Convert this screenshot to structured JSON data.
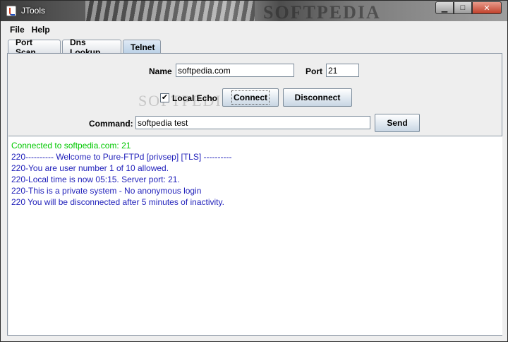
{
  "window": {
    "title": "JTools",
    "title_watermark": "SOFTPEDIA"
  },
  "menu": [
    "File",
    "Help"
  ],
  "tabs": [
    {
      "label": "Port Scan",
      "active": false
    },
    {
      "label": "Dns Lookup",
      "active": false
    },
    {
      "label": "Telnet",
      "active": true
    }
  ],
  "telnet": {
    "name_label": "Name",
    "name_value": "softpedia.com",
    "port_label": "Port",
    "port_value": "21",
    "local_echo_label": "Local Echo",
    "local_echo_checked": true,
    "connect_label": "Connect",
    "disconnect_label": "Disconnect",
    "command_label": "Command:",
    "command_value": "softpedia test",
    "send_label": "Send",
    "watermark": "SOFTPEDIA"
  },
  "output": {
    "lines": [
      {
        "text": "Connected to softpedia.com: 21",
        "color": "#00c800"
      },
      {
        "text": "220---------- Welcome to Pure-FTPd [privsep] [TLS] ----------",
        "color": "#2222bb"
      },
      {
        "text": "220-You are user number 1 of 10 allowed.",
        "color": "#2222bb"
      },
      {
        "text": "220-Local time is now 05:15. Server port: 21.",
        "color": "#2222bb"
      },
      {
        "text": "220-This is a private system - No anonymous login",
        "color": "#2222bb"
      },
      {
        "text": "220 You will be disconnected after 5 minutes of inactivity.",
        "color": "#2222bb"
      }
    ]
  }
}
